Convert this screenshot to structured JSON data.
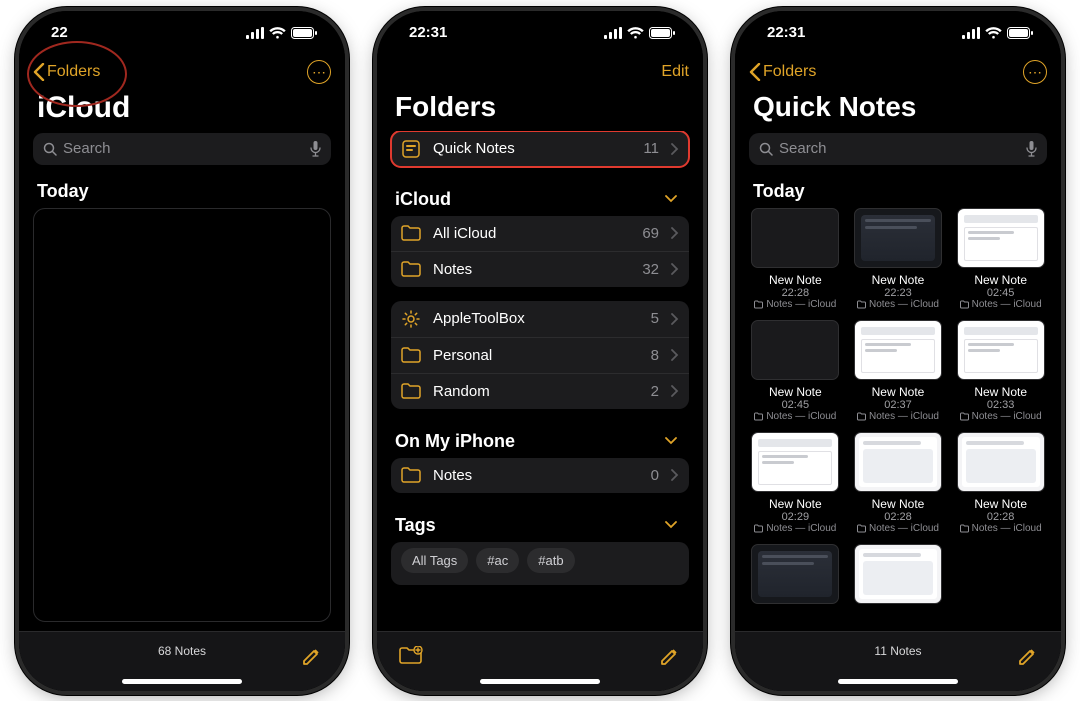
{
  "status": {
    "time_p1": "22",
    "time_p2": "22:31",
    "time_p3": "22:31"
  },
  "phone1": {
    "back_label": "Folders",
    "title": "iCloud",
    "search_placeholder": "Search",
    "section": "Today",
    "footer_count": "68 Notes"
  },
  "phone2": {
    "edit": "Edit",
    "title": "Folders",
    "quick": {
      "label": "Quick Notes",
      "count": "11"
    },
    "icloud_header": "iCloud",
    "icloud": [
      {
        "label": "All iCloud",
        "count": "69",
        "icon": "folder"
      },
      {
        "label": "Notes",
        "count": "32",
        "icon": "folder"
      }
    ],
    "icloud2": [
      {
        "label": "AppleToolBox",
        "count": "5",
        "icon": "gear"
      },
      {
        "label": "Personal",
        "count": "8",
        "icon": "folder"
      },
      {
        "label": "Random",
        "count": "2",
        "icon": "folder"
      }
    ],
    "omi_header": "On My iPhone",
    "omi": [
      {
        "label": "Notes",
        "count": "0",
        "icon": "folder"
      }
    ],
    "tags_header": "Tags",
    "tags": [
      "All Tags",
      "#ac",
      "#atb"
    ]
  },
  "phone3": {
    "back_label": "Folders",
    "title": "Quick Notes",
    "search_placeholder": "Search",
    "section": "Today",
    "footer_count": "11 Notes",
    "loc": "Notes — iCloud",
    "notes": [
      {
        "title": "New Note",
        "time": "22:28",
        "thumb": "blank"
      },
      {
        "title": "New Note",
        "time": "22:23",
        "thumb": "dark"
      },
      {
        "title": "New Note",
        "time": "02:45",
        "thumb": "white"
      },
      {
        "title": "New Note",
        "time": "02:45",
        "thumb": "blank"
      },
      {
        "title": "New Note",
        "time": "02:37",
        "thumb": "white"
      },
      {
        "title": "New Note",
        "time": "02:33",
        "thumb": "white"
      },
      {
        "title": "New Note",
        "time": "02:29",
        "thumb": "white"
      },
      {
        "title": "New Note",
        "time": "02:28",
        "thumb": "light"
      },
      {
        "title": "New Note",
        "time": "02:28",
        "thumb": "light"
      },
      {
        "title": "",
        "time": "",
        "thumb": "dark"
      },
      {
        "title": "",
        "time": "",
        "thumb": "light"
      }
    ]
  }
}
